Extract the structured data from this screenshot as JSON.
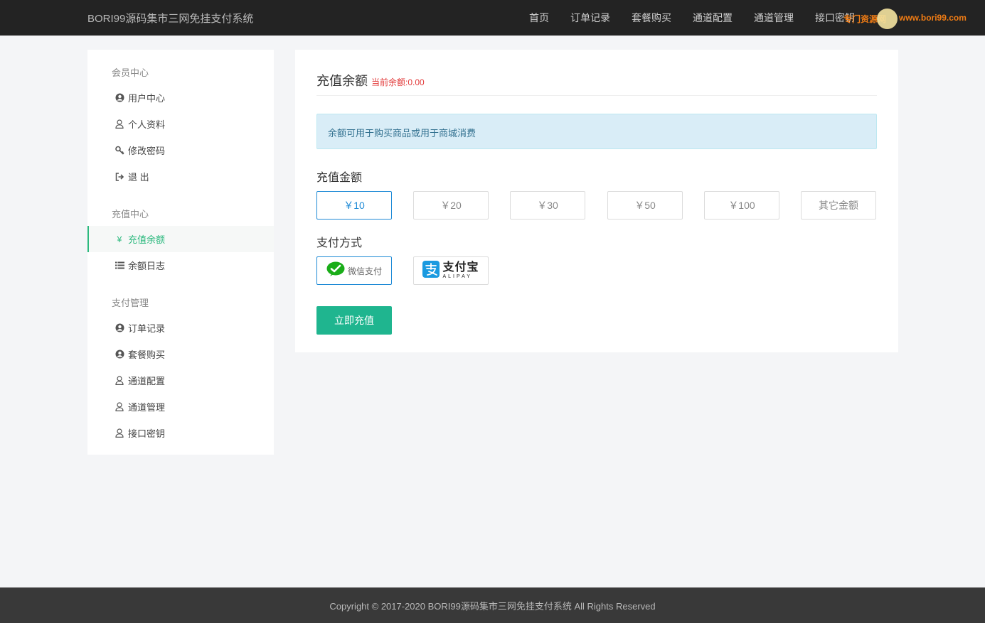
{
  "header": {
    "brand": "BORI99源码集市三网免挂支付系统",
    "nav": [
      "首页",
      "订单记录",
      "套餐购买",
      "通道配置",
      "通道管理",
      "接口密钥"
    ],
    "watermark_text": "专门资源网",
    "watermark_url": "www.bori99.com"
  },
  "sidebar": {
    "sections": [
      {
        "title": "会员中心",
        "items": [
          {
            "label": "用户中心",
            "icon": "user-circle-icon"
          },
          {
            "label": "个人资料",
            "icon": "user-icon"
          },
          {
            "label": "修改密码",
            "icon": "key-icon"
          },
          {
            "label": "退 出",
            "icon": "sign-out-icon"
          }
        ]
      },
      {
        "title": "充值中心",
        "items": [
          {
            "label": "充值余额",
            "icon": "yen-icon",
            "active": true
          },
          {
            "label": "余额日志",
            "icon": "list-icon"
          }
        ]
      },
      {
        "title": "支付管理",
        "items": [
          {
            "label": "订单记录",
            "icon": "user-circle-icon"
          },
          {
            "label": "套餐购买",
            "icon": "user-circle-icon"
          },
          {
            "label": "通道配置",
            "icon": "user-icon"
          },
          {
            "label": "通道管理",
            "icon": "user-icon"
          },
          {
            "label": "接口密钥",
            "icon": "user-icon"
          }
        ]
      }
    ]
  },
  "main": {
    "title": "充值余额",
    "balance_label": "当前余额:0.00",
    "notice": "余额可用于购买商品或用于商城消费",
    "amount_label": "充值金额",
    "amounts": [
      "￥10",
      "￥20",
      "￥30",
      "￥50",
      "￥100",
      "其它金额"
    ],
    "selected_amount": "￥10",
    "payment_label": "支付方式",
    "payment_methods": {
      "wechat": "微信支付",
      "alipay_cn": "支付宝",
      "alipay_en": "ALIPAY"
    },
    "selected_payment": "微信支付",
    "submit_label": "立即充值"
  },
  "footer": {
    "copyright": "Copyright © 2017-2020 BORI99源码集市三网免挂支付系统 All Rights Reserved"
  },
  "colors": {
    "accent_green": "#2cb97e",
    "submit_green": "#1fb58f",
    "selected_blue": "#1e8ad6",
    "balance_red": "#e23a3a",
    "topbar_bg": "#232323"
  }
}
